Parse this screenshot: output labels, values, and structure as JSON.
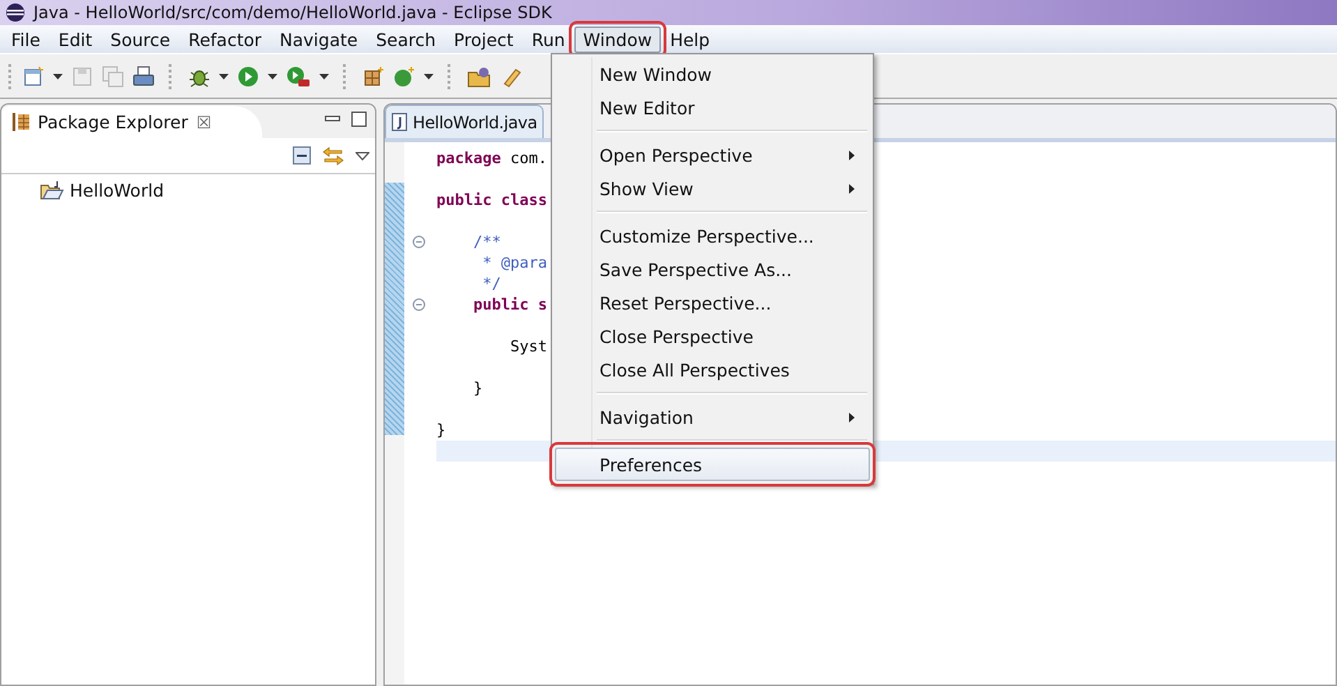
{
  "window": {
    "title": "Java - HelloWorld/src/com/demo/HelloWorld.java - Eclipse SDK"
  },
  "menu_bar": [
    {
      "label": "File",
      "selected": false,
      "highlighted": false
    },
    {
      "label": "Edit",
      "selected": false,
      "highlighted": false
    },
    {
      "label": "Source",
      "selected": false,
      "highlighted": false
    },
    {
      "label": "Refactor",
      "selected": false,
      "highlighted": false
    },
    {
      "label": "Navigate",
      "selected": false,
      "highlighted": false
    },
    {
      "label": "Search",
      "selected": false,
      "highlighted": false
    },
    {
      "label": "Project",
      "selected": false,
      "highlighted": false
    },
    {
      "label": "Run",
      "selected": false,
      "highlighted": false
    },
    {
      "label": "Window",
      "selected": true,
      "highlighted": true
    },
    {
      "label": "Help",
      "selected": false,
      "highlighted": false
    }
  ],
  "package_explorer": {
    "title": "Package Explorer",
    "close": "☒",
    "tree": [
      {
        "label": "HelloWorld"
      }
    ]
  },
  "editor": {
    "tab": "HelloWorld.java",
    "lines": [
      {
        "kind": "code",
        "fold": false,
        "tokens": [
          {
            "text": "package",
            "kind": "keyword"
          },
          {
            "text": " com.",
            "kind": "plain"
          }
        ]
      },
      {
        "kind": "blank"
      },
      {
        "kind": "code",
        "fold": false,
        "tokens": [
          {
            "text": "public class",
            "kind": "keyword"
          }
        ]
      },
      {
        "kind": "blank"
      },
      {
        "kind": "code",
        "fold": true,
        "tokens": [
          {
            "text": "    /**",
            "kind": "comment"
          }
        ]
      },
      {
        "kind": "code",
        "fold": false,
        "tokens": [
          {
            "text": "     * @para",
            "kind": "comment"
          }
        ]
      },
      {
        "kind": "code",
        "fold": false,
        "tokens": [
          {
            "text": "     */",
            "kind": "comment"
          }
        ]
      },
      {
        "kind": "code",
        "fold": true,
        "tokens": [
          {
            "text": "    public s",
            "kind": "keyword"
          }
        ]
      },
      {
        "kind": "blank"
      },
      {
        "kind": "code",
        "fold": false,
        "tokens": [
          {
            "text": "        Syst",
            "kind": "plain"
          }
        ]
      },
      {
        "kind": "blank"
      },
      {
        "kind": "code",
        "fold": false,
        "tokens": [
          {
            "text": "    }",
            "kind": "plain"
          }
        ]
      },
      {
        "kind": "blank"
      },
      {
        "kind": "code",
        "fold": false,
        "tokens": [
          {
            "text": "}",
            "kind": "plain"
          }
        ]
      },
      {
        "kind": "current"
      }
    ]
  },
  "window_menu": {
    "groups": [
      [
        {
          "label": "New Window",
          "submenu": false,
          "highlighted": false
        },
        {
          "label": "New Editor",
          "submenu": false,
          "highlighted": false
        }
      ],
      [
        {
          "label": "Open Perspective",
          "submenu": true,
          "highlighted": false
        },
        {
          "label": "Show View",
          "submenu": true,
          "highlighted": false
        }
      ],
      [
        {
          "label": "Customize Perspective...",
          "submenu": false,
          "highlighted": false
        },
        {
          "label": "Save Perspective As...",
          "submenu": false,
          "highlighted": false
        },
        {
          "label": "Reset Perspective...",
          "submenu": false,
          "highlighted": false
        },
        {
          "label": "Close Perspective",
          "submenu": false,
          "highlighted": false
        },
        {
          "label": "Close All Perspectives",
          "submenu": false,
          "highlighted": false
        }
      ],
      [
        {
          "label": "Navigation",
          "submenu": true,
          "highlighted": false
        }
      ],
      [
        {
          "label": "Preferences",
          "submenu": false,
          "highlighted": true
        }
      ]
    ]
  }
}
